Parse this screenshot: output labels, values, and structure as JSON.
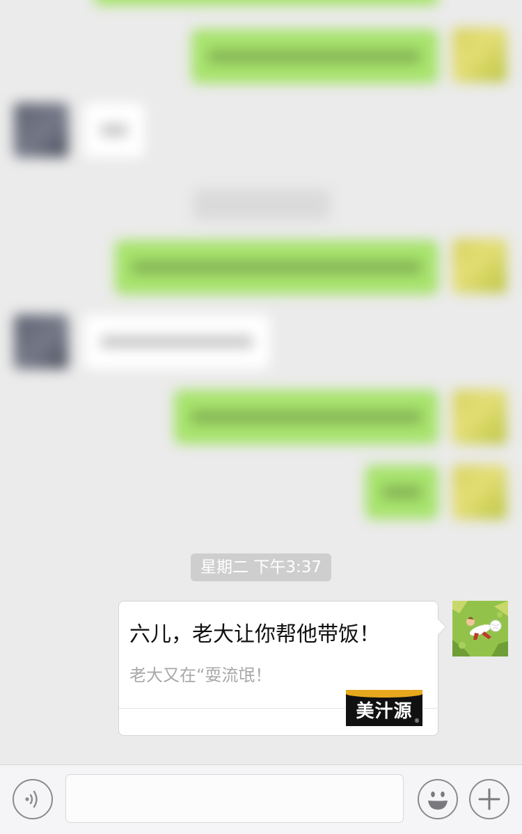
{
  "conversation": {
    "timestamp": "星期二 下午3:37",
    "link_card": {
      "title": "六儿，老大让你帮他带饭！",
      "description": "老大又在“耍流氓！",
      "source_logo": "美汁源"
    }
  },
  "input_bar": {
    "message_value": "",
    "voice_icon": "voice-wave-icon",
    "emoji_icon": "smiley-face-icon",
    "more_icon": "plus-icon"
  },
  "colors": {
    "chat_background": "#ebebeb",
    "outgoing_bubble": "#a7e36c",
    "incoming_bubble": "#ffffff",
    "timestamp_pill": "#cecece",
    "logo_band": "#e7a81e"
  }
}
